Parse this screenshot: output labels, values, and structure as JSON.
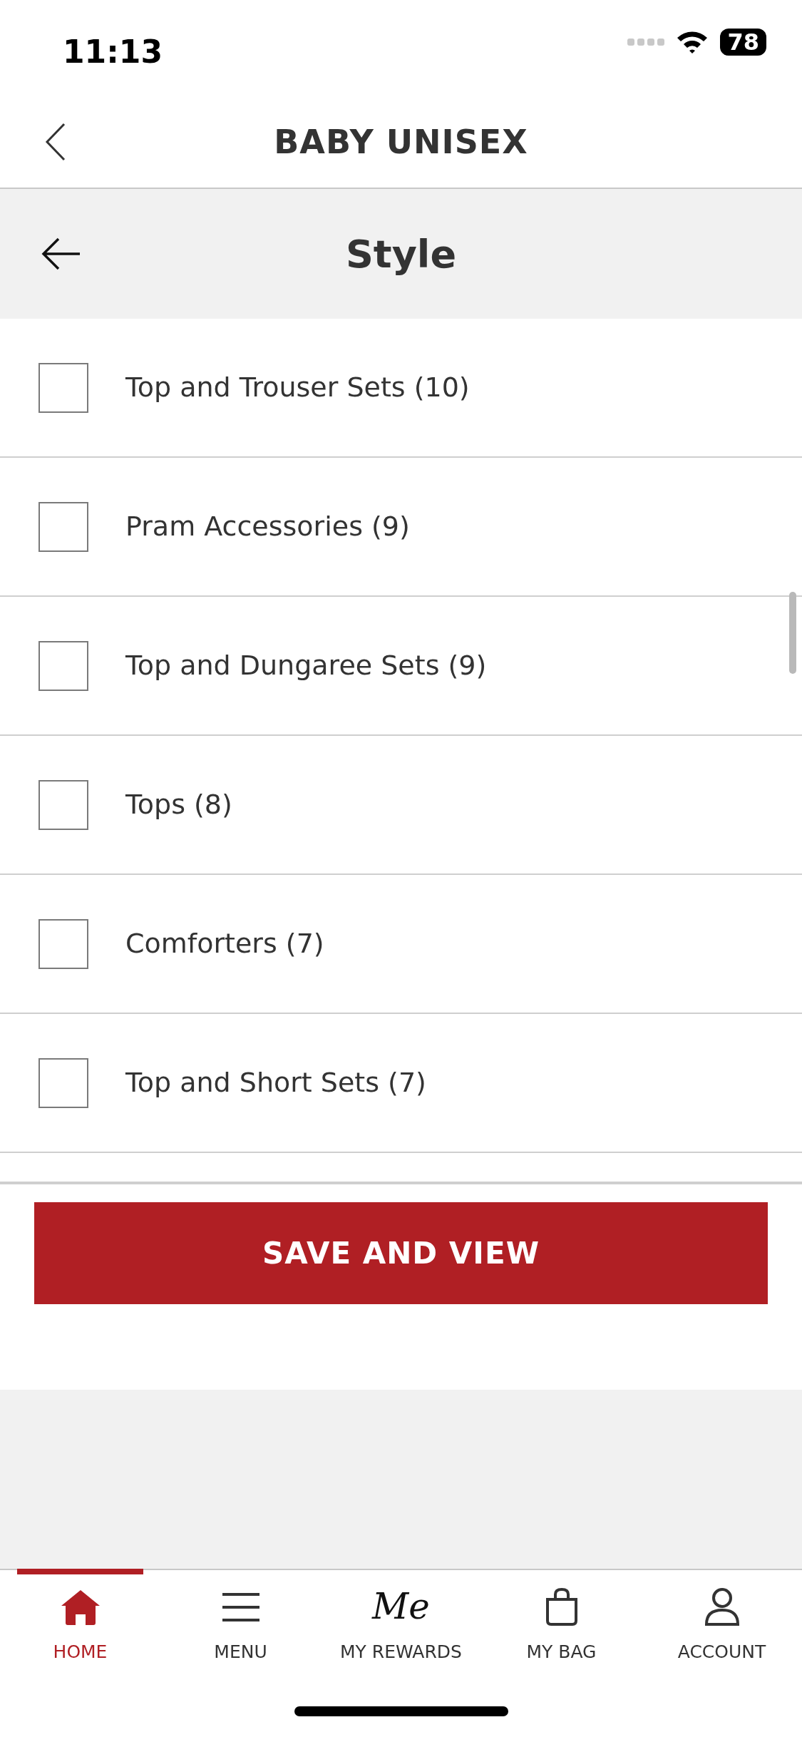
{
  "status_bar": {
    "time": "11:13",
    "battery": "78"
  },
  "header": {
    "title": "BABY UNISEX"
  },
  "filter_panel": {
    "title": "Style"
  },
  "options": [
    {
      "label": "Top and Trouser Sets (10)",
      "checked": false
    },
    {
      "label": "Pram Accessories (9)",
      "checked": false
    },
    {
      "label": "Top and Dungaree Sets (9)",
      "checked": false
    },
    {
      "label": "Tops (8)",
      "checked": false
    },
    {
      "label": "Comforters (7)",
      "checked": false
    },
    {
      "label": "Top and Short Sets (7)",
      "checked": false
    }
  ],
  "save_button": "SAVE AND VIEW",
  "tab_bar": [
    {
      "kind": "home",
      "label": "HOME",
      "selected": true
    },
    {
      "kind": "menu",
      "label": "MENU",
      "selected": false
    },
    {
      "kind": "rewards",
      "label": "MY REWARDS",
      "logo": "Me",
      "selected": false
    },
    {
      "kind": "bag",
      "label": "MY BAG",
      "selected": false
    },
    {
      "kind": "account",
      "label": "ACCOUNT",
      "selected": false
    }
  ]
}
